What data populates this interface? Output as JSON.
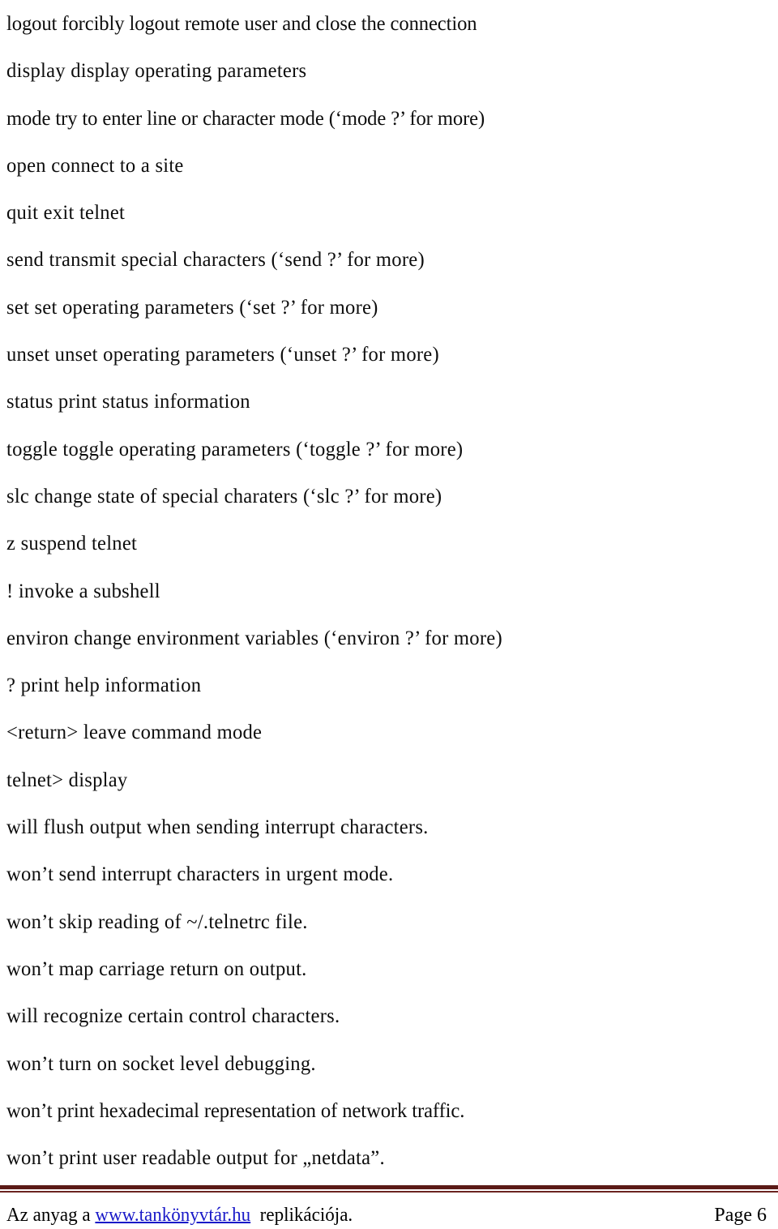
{
  "document": {
    "kind": "scanned-text-page",
    "page_label": "Page 6",
    "body_lines": [
      "logout forcibly logout remote user and close the connection",
      "display display operating parameters",
      "mode try to enter line or character mode (‘mode ?’ for more)",
      "open connect to a site",
      "quit exit telnet",
      "send transmit special characters (‘send ?’ for more)",
      "set set operating parameters (‘set ?’ for more)",
      "unset unset operating parameters (‘unset ?’ for more)",
      "status print status information",
      "toggle toggle operating parameters (‘toggle ?’ for more)",
      "slc change state of special charaters (‘slc ?’ for more)",
      "z suspend telnet",
      "! invoke a subshell",
      "environ change environment variables (‘environ ?’ for more)",
      "? print help information",
      "<return> leave command mode",
      "telnet> display",
      "will flush output when sending interrupt characters.",
      "won’t send interrupt characters in urgent mode.",
      "won’t skip reading of ~/.telnetrc file.",
      "won’t map carriage return on output.",
      "will recognize certain control characters.",
      "won’t turn on socket level debugging.",
      "won’t print hexadecimal representation of network traffic.",
      "won’t print user readable output for „netdata”."
    ]
  },
  "footer": {
    "text_before_link": "Az anyag a ",
    "link_text": "www.tankönyvtár.hu",
    "text_after_link": "  replikációja.",
    "page_label": "Page 6",
    "rule_color": "#5b1a17",
    "link_color": "#1919c8"
  }
}
